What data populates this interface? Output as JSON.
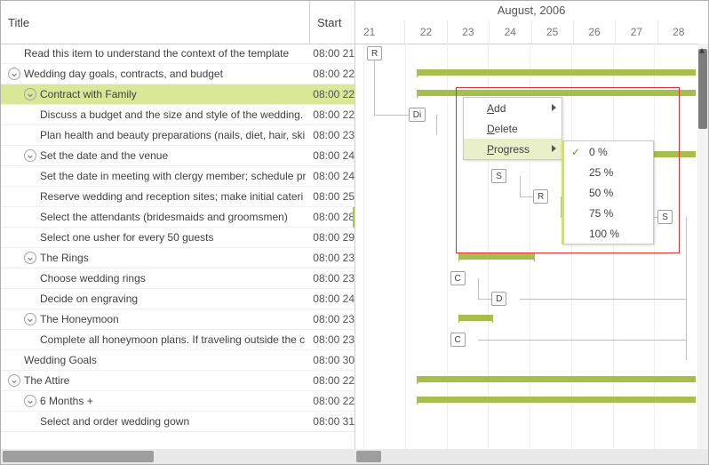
{
  "header": {
    "title_col": "Title",
    "start_col": "Start",
    "month": "August, 2006",
    "days": [
      "21",
      "22",
      "23",
      "24",
      "25",
      "26",
      "27",
      "28"
    ]
  },
  "rows": [
    {
      "indent": 1,
      "exp": false,
      "title": "Read this item to understand the context of the template",
      "start": "08:00 21"
    },
    {
      "indent": 0,
      "exp": true,
      "title": "Wedding day goals, contracts, and budget",
      "start": "08:00 22"
    },
    {
      "indent": 1,
      "exp": true,
      "title": "Contract with Family",
      "start": "08:00 22",
      "selected": true
    },
    {
      "indent": 2,
      "exp": false,
      "title": "Discuss a budget and the size and style of the wedding.",
      "start": "08:00 22"
    },
    {
      "indent": 2,
      "exp": false,
      "title": "Plan health and beauty preparations (nails, diet, hair, ski",
      "start": "08:00 23"
    },
    {
      "indent": 1,
      "exp": true,
      "title": "Set the date and the venue",
      "start": "08:00 24"
    },
    {
      "indent": 2,
      "exp": false,
      "title": "Set the date in meeting with clergy member; schedule pr",
      "start": "08:00 24"
    },
    {
      "indent": 2,
      "exp": false,
      "title": "Reserve wedding and reception sites; make initial cateri",
      "start": "08:00 25"
    },
    {
      "indent": 2,
      "exp": false,
      "title": "Select the attendants (bridesmaids and groomsmen)",
      "start": "08:00 28",
      "mark": true
    },
    {
      "indent": 2,
      "exp": false,
      "title": "Select one usher for every 50 guests",
      "start": "08:00 29"
    },
    {
      "indent": 1,
      "exp": true,
      "title": "The Rings",
      "start": "08:00 23"
    },
    {
      "indent": 2,
      "exp": false,
      "title": "Choose wedding rings",
      "start": "08:00 23"
    },
    {
      "indent": 2,
      "exp": false,
      "title": "Decide on engraving",
      "start": "08:00 24"
    },
    {
      "indent": 1,
      "exp": true,
      "title": "The Honeymoon",
      "start": "08:00 23"
    },
    {
      "indent": 2,
      "exp": false,
      "title": "Complete all honeymoon plans. If traveling outside the c",
      "start": "08:00 23"
    },
    {
      "indent": 1,
      "exp": false,
      "title": "Wedding Goals",
      "start": "08:00 30"
    },
    {
      "indent": 0,
      "exp": true,
      "title": "The Attire",
      "start": "08:00 22"
    },
    {
      "indent": 1,
      "exp": true,
      "title": "6 Months +",
      "start": "08:00 22"
    },
    {
      "indent": 2,
      "exp": false,
      "title": "Select and order wedding gown",
      "start": "08:00 31"
    }
  ],
  "gantt": {
    "tasks": [
      {
        "row": 0,
        "col": 0,
        "label": "R"
      },
      {
        "row": 3,
        "col": 1,
        "label": "Di"
      },
      {
        "row": 6,
        "col": 3,
        "label": "S"
      },
      {
        "row": 7,
        "col": 4,
        "label": "R"
      },
      {
        "row": 8,
        "col": 7,
        "label": "S"
      },
      {
        "row": 11,
        "col": 2,
        "label": "C"
      },
      {
        "row": 12,
        "col": 3,
        "label": "D"
      },
      {
        "row": 14,
        "col": 2,
        "label": "C"
      }
    ],
    "summaries": [
      {
        "row": 1,
        "start": 1.3,
        "end": 8.3
      },
      {
        "row": 2,
        "start": 1.3,
        "end": 8.3
      },
      {
        "row": 5,
        "start": 3.3,
        "end": 8.3
      },
      {
        "row": 10,
        "start": 2.3,
        "end": 4.1
      },
      {
        "row": 13,
        "start": 2.3,
        "end": 3.1
      },
      {
        "row": 16,
        "start": 1.3,
        "end": 8.3
      },
      {
        "row": 17,
        "start": 1.3,
        "end": 8.3
      }
    ]
  },
  "menu": {
    "items": [
      {
        "label": "Add",
        "arrow": true,
        "accel": "A"
      },
      {
        "label": "Delete",
        "accel": "D"
      },
      {
        "label": "Progress",
        "arrow": true,
        "hover": true,
        "accel": "P"
      }
    ],
    "sub": [
      {
        "label": "0 %",
        "checked": true
      },
      {
        "label": "25 %"
      },
      {
        "label": "50 %"
      },
      {
        "label": "75 %"
      },
      {
        "label": "100 %"
      }
    ]
  }
}
